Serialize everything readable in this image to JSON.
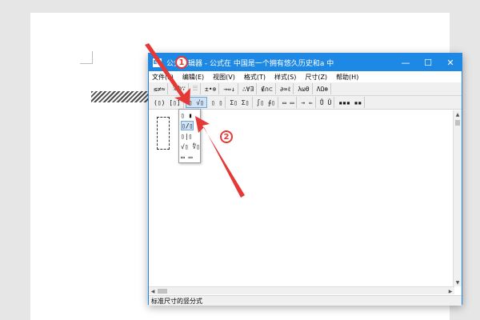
{
  "window": {
    "title": "公式编辑器 - 公式在 中国是一个拥有悠久历史和a 中",
    "app_icon": "Eq"
  },
  "menu": [
    "文件(F)",
    "编辑(E)",
    "视图(V)",
    "格式(T)",
    "样式(S)",
    "尺寸(Z)",
    "帮助(H)"
  ],
  "toolbar1": [
    "≤≠≈",
    "⫶ab∵",
    "⫶⫶⫶",
    "±•⊗",
    "→⇔↓",
    "∴∀∃",
    "∉∩⊂",
    "∂∞ℓ",
    "λωθ",
    "ΛΩ⊛"
  ],
  "toolbar2": [
    "(▯) [▯]",
    "▯ √▯",
    "▯ ▯",
    "Σ▯ Σ▯",
    "∫▯ ∮▯",
    "▭ ▭",
    "→ ⇐",
    "Ů Ũ",
    "▪▪▪ ▪▪"
  ],
  "dropdown": [
    "▯ ▮",
    "▯/▯",
    "▯|▯",
    "√▯ ∜▯",
    "▭ ▭"
  ],
  "status": "标准尺寸的竖分式",
  "markers": [
    "1",
    "2"
  ],
  "colors": {
    "titlebar": "#1e88e5",
    "marker": "#e53935"
  }
}
